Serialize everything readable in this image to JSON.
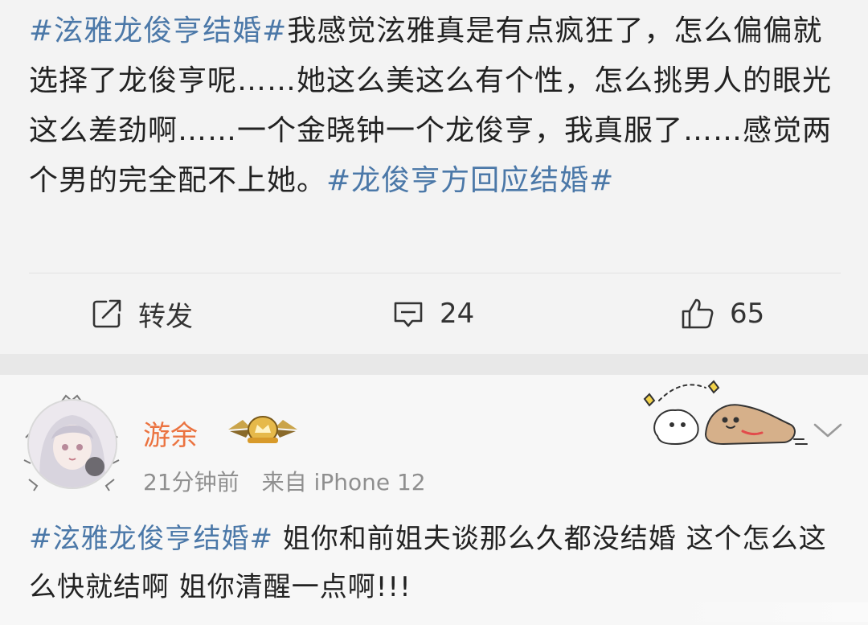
{
  "post": {
    "tag1": "#泫雅龙俊亨结婚#",
    "text": "我感觉泫雅真是有点疯狂了，怎么偏偏就选择了龙俊亨呢……她这么美这么有个性，怎么挑男人的眼光这么差劲啊……一个金晓钟一个龙俊亨，我真服了……感觉两个男的完全配不上她。",
    "tag2": "#龙俊亨方回应结婚#"
  },
  "actions": {
    "repost_label": "转发",
    "comment_count": "24",
    "like_count": "65"
  },
  "comment": {
    "username": "游余",
    "time": "21分钟前",
    "source": "来自 iPhone 12",
    "tag": "#泫雅龙俊亨结婚#",
    "text": " 姐你和前姐夫谈那么久都没结婚 这个怎么这么快就结啊 姐你清醒一点啊!!!"
  },
  "icons": {
    "repost": "edit-share-icon",
    "comment": "comment-bubble-icon",
    "like": "thumbs-up-icon",
    "more": "chevron-down-icon"
  },
  "colors": {
    "hashtag": "#4b78a8",
    "username": "#eb7340",
    "meta": "#8f8f8f",
    "text": "#222222"
  }
}
